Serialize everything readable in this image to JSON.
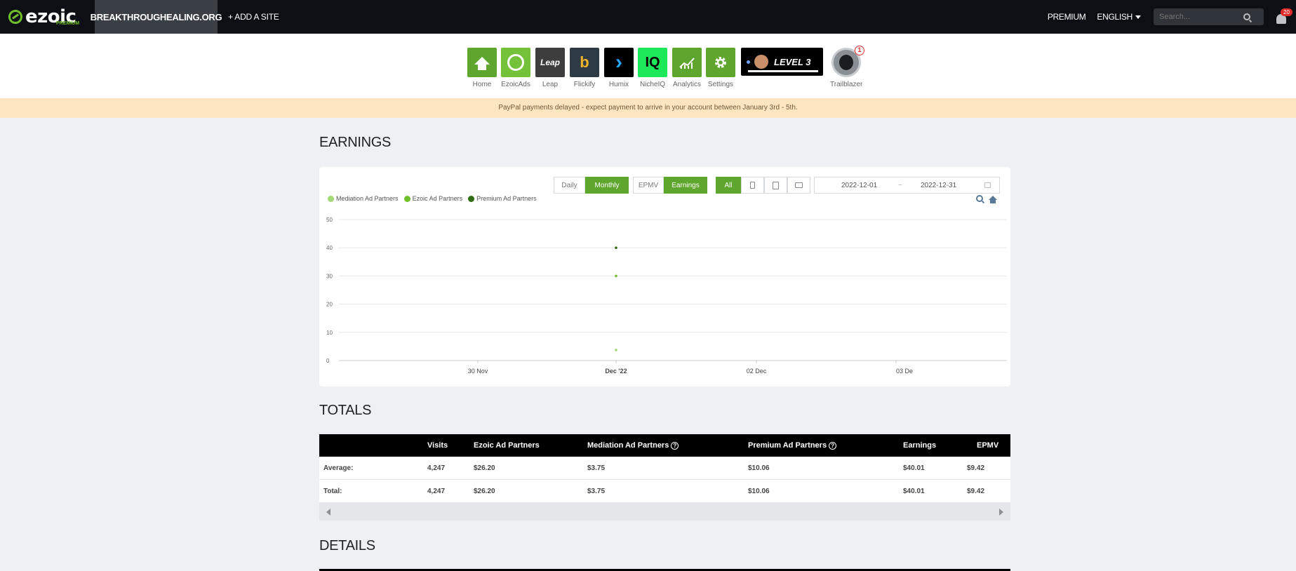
{
  "topbar": {
    "logo_text": "ezoic",
    "logo_sub": "PREMIUM",
    "site": "BREAKTHROUGHEALING.ORG",
    "add_site": "+ ADD A SITE",
    "premium": "PREMIUM",
    "language": "ENGLISH",
    "search_placeholder": "Search...",
    "notifications": "20"
  },
  "apps": [
    {
      "label": "Home",
      "color": "#5ea62d"
    },
    {
      "label": "EzoicAds",
      "color": "#74c23a"
    },
    {
      "label": "Leap",
      "color": "#3d3d3d",
      "glyph": "Leap"
    },
    {
      "label": "Flickify",
      "color": "#2f3b44",
      "glyph": "b"
    },
    {
      "label": "Humix",
      "color": "#000000",
      "glyph": "›"
    },
    {
      "label": "NicheIQ",
      "color": "#1ce85a",
      "glyph": "IQ"
    },
    {
      "label": "Analytics",
      "color": "#5ea62d"
    },
    {
      "label": "Settings",
      "color": "#5ea62d"
    }
  ],
  "level": {
    "label": "LEVEL 3"
  },
  "trailblazer": {
    "label": "Trailblazer",
    "badge": "1"
  },
  "banner": "PayPal payments delayed - expect payment to arrive in your account between January 3rd - 5th.",
  "earnings": {
    "title": "EARNINGS",
    "period_buttons": [
      "Daily",
      "Monthly"
    ],
    "metric_buttons": [
      "EPMV",
      "Earnings"
    ],
    "device_all": "All",
    "date_from": "2022-12-01",
    "date_sep": "~",
    "date_to": "2022-12-31"
  },
  "chart_data": {
    "type": "scatter",
    "legend": [
      {
        "name": "Mediation Ad Partners",
        "color": "#a3d977"
      },
      {
        "name": "Ezoic Ad Partners",
        "color": "#6fbf2a"
      },
      {
        "name": "Premium Ad Partners",
        "color": "#2e6b12"
      }
    ],
    "x_ticks": [
      "30 Nov",
      "Dec '22",
      "02 Dec",
      "03 De"
    ],
    "y_ticks": [
      0,
      10,
      20,
      30,
      40,
      50
    ],
    "ylim": [
      0,
      50
    ],
    "points": [
      {
        "series": "Mediation Ad Partners",
        "x": "Dec '22",
        "y": 3.75
      },
      {
        "series": "Ezoic Ad Partners",
        "x": "Dec '22",
        "y": 30
      },
      {
        "series": "Premium Ad Partners",
        "x": "Dec '22",
        "y": 40
      }
    ]
  },
  "totals": {
    "title": "TOTALS",
    "headers": [
      "",
      "Visits",
      "Ezoic Ad Partners",
      "Mediation Ad Partners",
      "Premium Ad Partners",
      "Earnings",
      "EPMV"
    ],
    "rows": [
      [
        "Average:",
        "4,247",
        "$26.20",
        "$3.75",
        "$10.06",
        "$40.01",
        "$9.42"
      ],
      [
        "Total:",
        "4,247",
        "$26.20",
        "$3.75",
        "$10.06",
        "$40.01",
        "$9.42"
      ]
    ]
  },
  "details": {
    "title": "DETAILS"
  }
}
